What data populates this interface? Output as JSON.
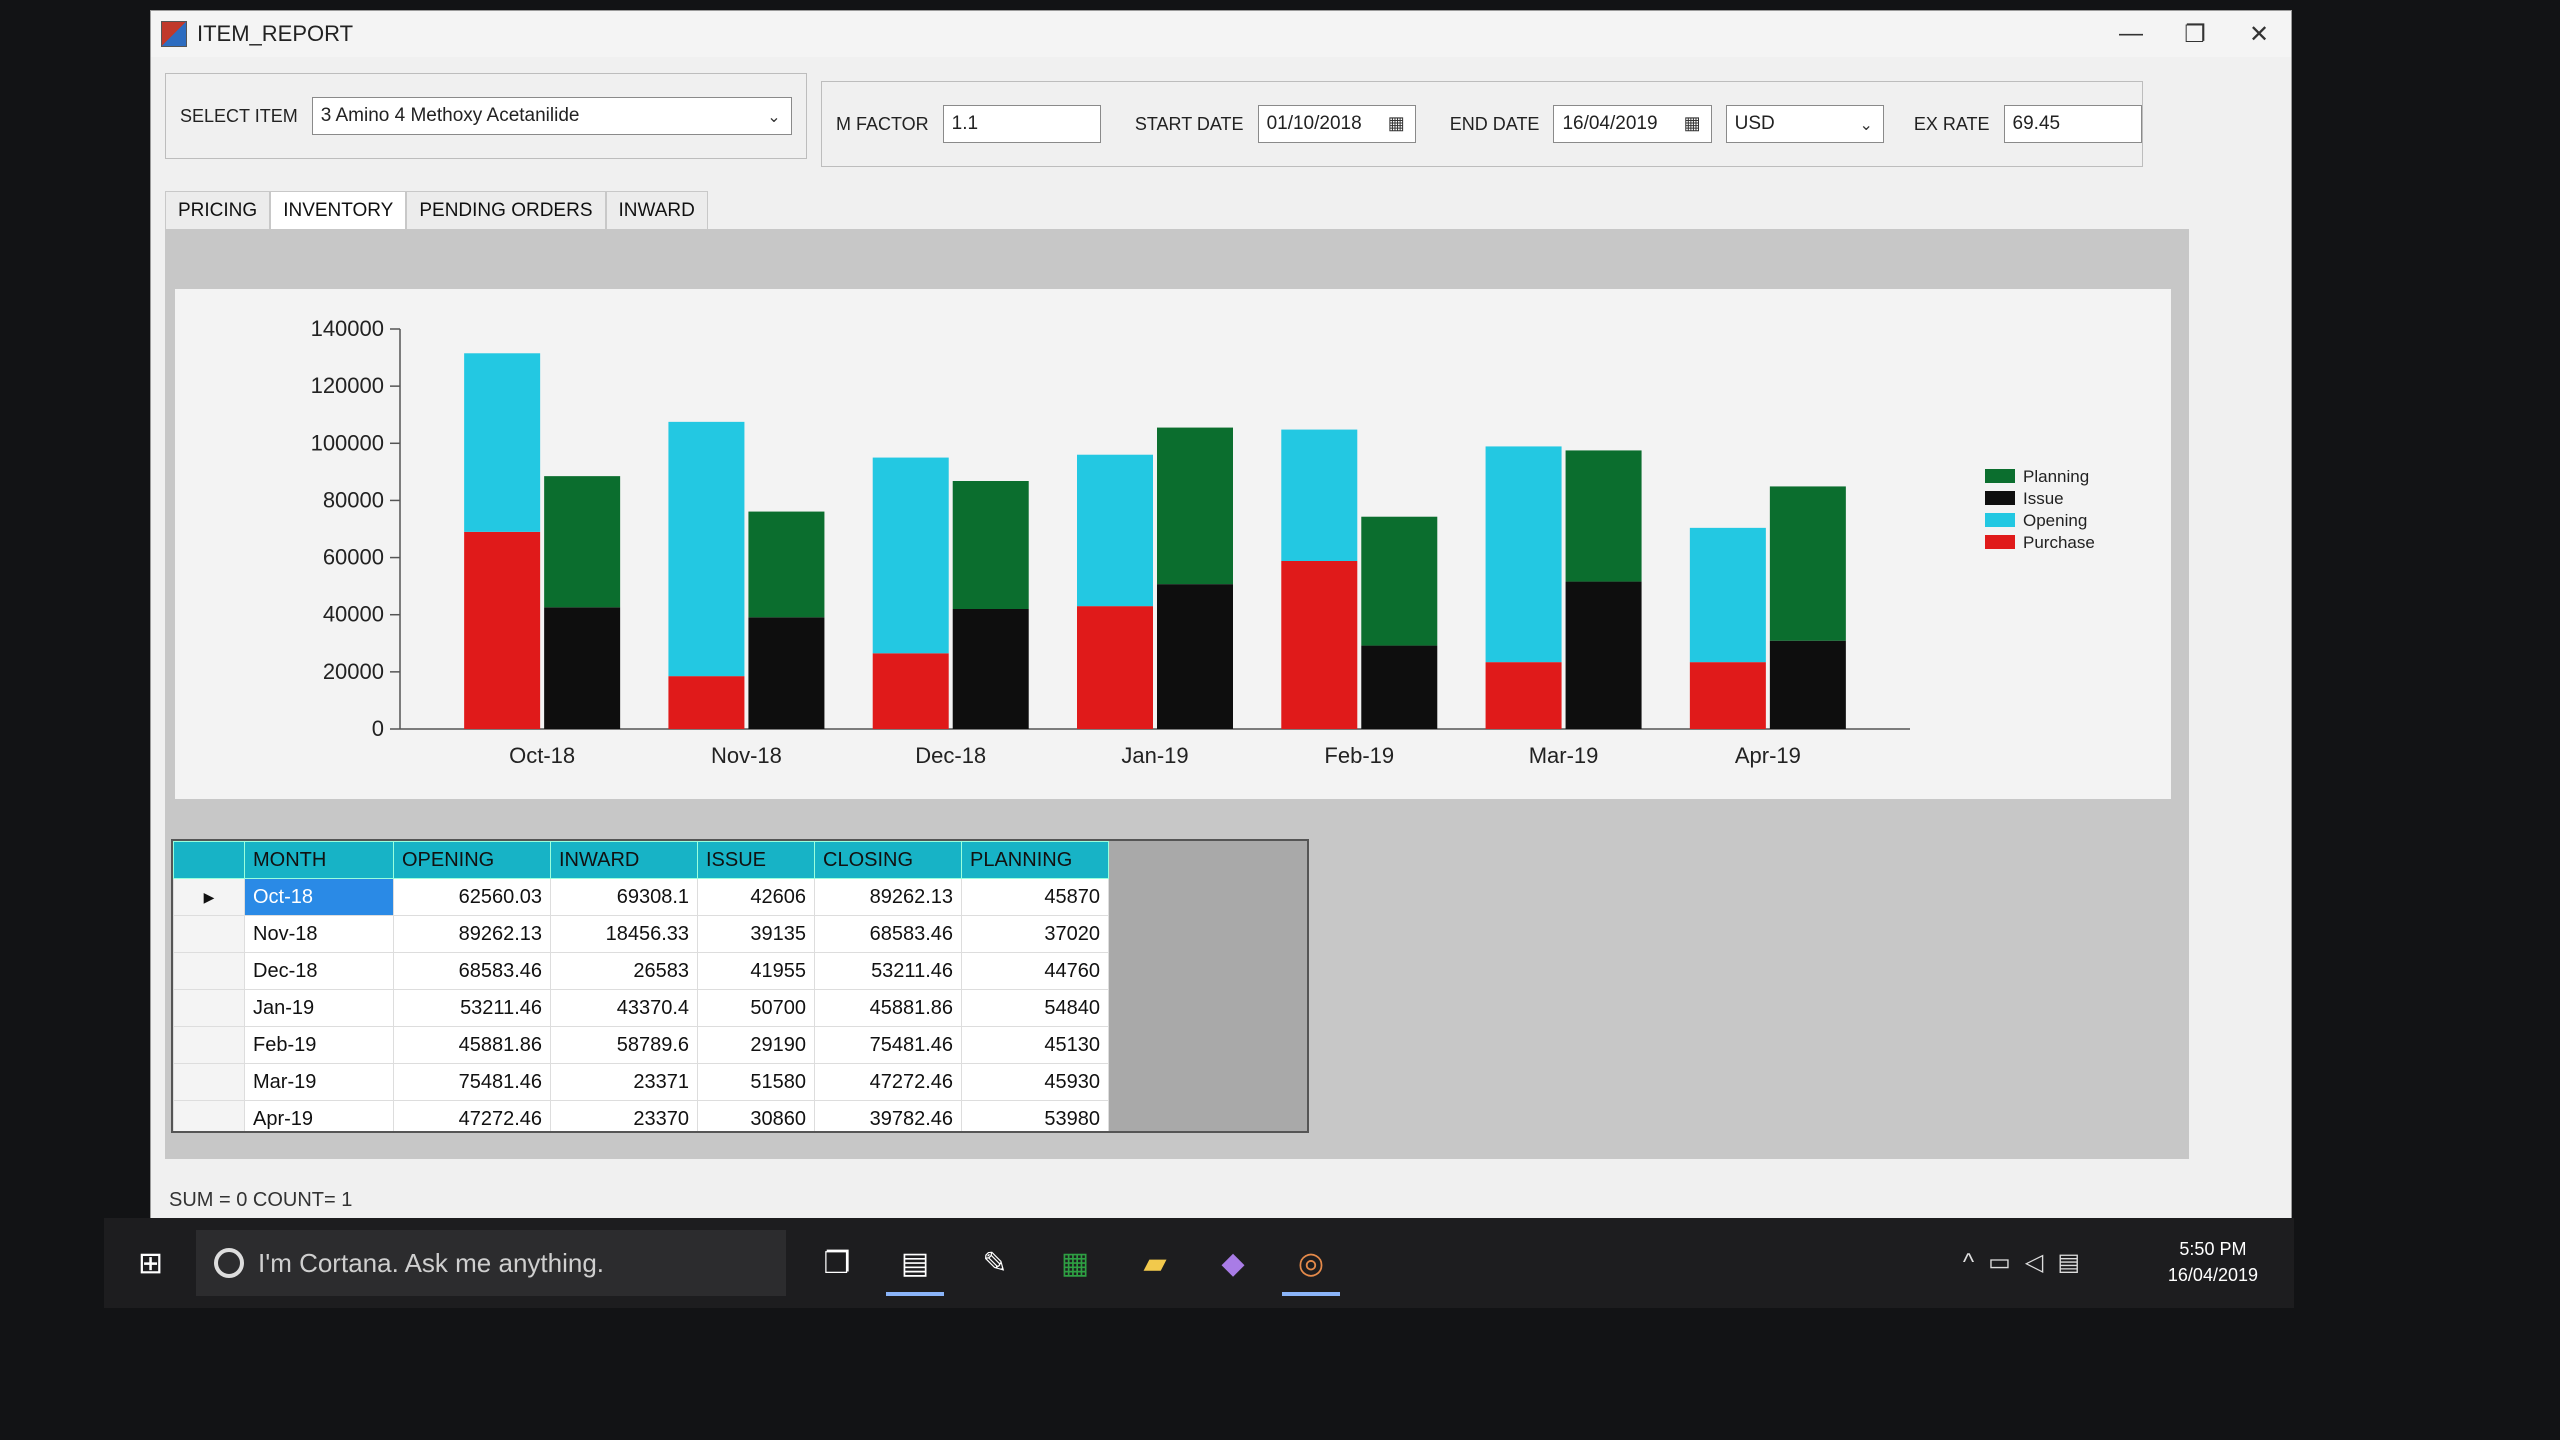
{
  "window": {
    "title": "ITEM_REPORT",
    "minimize": "—",
    "restore": "❐",
    "close": "✕"
  },
  "toolbar": {
    "select_item_label": "SELECT ITEM",
    "select_item_value": "3 Amino 4 Methoxy Acetanilide",
    "m_factor_label": "M FACTOR",
    "m_factor_value": "1.1",
    "start_date_label": "START DATE",
    "start_date_value": "01/10/2018",
    "end_date_label": "END DATE",
    "end_date_value": "16/04/2019",
    "currency_value": "USD",
    "ex_rate_label": "EX RATE",
    "ex_rate_value": "69.45"
  },
  "tabs": [
    {
      "label": "PRICING"
    },
    {
      "label": "INVENTORY",
      "active": true
    },
    {
      "label": "PENDING ORDERS"
    },
    {
      "label": "INWARD"
    }
  ],
  "colors": {
    "planning": "#0b6e2e",
    "issue": "#0e0e0e",
    "opening": "#23c8e2",
    "purchase": "#e01a1a"
  },
  "chart_data": {
    "type": "bar",
    "stacked_groups": true,
    "categories": [
      "Oct-18",
      "Nov-18",
      "Dec-18",
      "Jan-19",
      "Feb-19",
      "Mar-19",
      "Apr-19"
    ],
    "series": [
      {
        "name": "Purchase",
        "stack": "left",
        "values": [
          69000,
          18500,
          26500,
          43000,
          58800,
          23400,
          23400
        ]
      },
      {
        "name": "Opening",
        "stack": "left",
        "values": [
          62500,
          89000,
          68500,
          53000,
          46000,
          75500,
          47000
        ]
      },
      {
        "name": "Issue",
        "stack": "right",
        "values": [
          42600,
          39100,
          42000,
          50700,
          29200,
          51600,
          30900
        ]
      },
      {
        "name": "Planning",
        "stack": "right",
        "values": [
          45900,
          37000,
          44800,
          54800,
          45100,
          45900,
          54000
        ]
      }
    ],
    "yticks": [
      "0",
      "20000",
      "40000",
      "60000",
      "80000",
      "100000",
      "120000",
      "140000"
    ],
    "ylim": [
      0,
      140000
    ],
    "legend": [
      "Planning",
      "Issue",
      "Opening",
      "Purchase"
    ],
    "legend_position": "right"
  },
  "table": {
    "columns": [
      "MONTH",
      "OPENING",
      "INWARD",
      "ISSUE",
      "CLOSING",
      "PLANNING"
    ],
    "rows": [
      [
        "Oct-18",
        "62560.03",
        "69308.1",
        "42606",
        "89262.13",
        "45870"
      ],
      [
        "Nov-18",
        "89262.13",
        "18456.33",
        "39135",
        "68583.46",
        "37020"
      ],
      [
        "Dec-18",
        "68583.46",
        "26583",
        "41955",
        "53211.46",
        "44760"
      ],
      [
        "Jan-19",
        "53211.46",
        "43370.4",
        "50700",
        "45881.86",
        "54840"
      ],
      [
        "Feb-19",
        "45881.86",
        "58789.6",
        "29190",
        "75481.46",
        "45130"
      ],
      [
        "Mar-19",
        "75481.46",
        "23371",
        "51580",
        "47272.46",
        "45930"
      ],
      [
        "Apr-19",
        "47272.46",
        "23370",
        "30860",
        "39782.46",
        "53980"
      ]
    ]
  },
  "status": {
    "text": "SUM = 0   COUNT= 1"
  },
  "taskbar": {
    "cortana_placeholder": "I'm Cortana. Ask me anything.",
    "time": "5:50 PM",
    "date": "16/04/2019",
    "icons": [
      "task-view-icon",
      "file-explorer-icon",
      "notepad-icon",
      "excel-icon",
      "folder-icon",
      "visual-studio-icon",
      "app-icon"
    ]
  }
}
